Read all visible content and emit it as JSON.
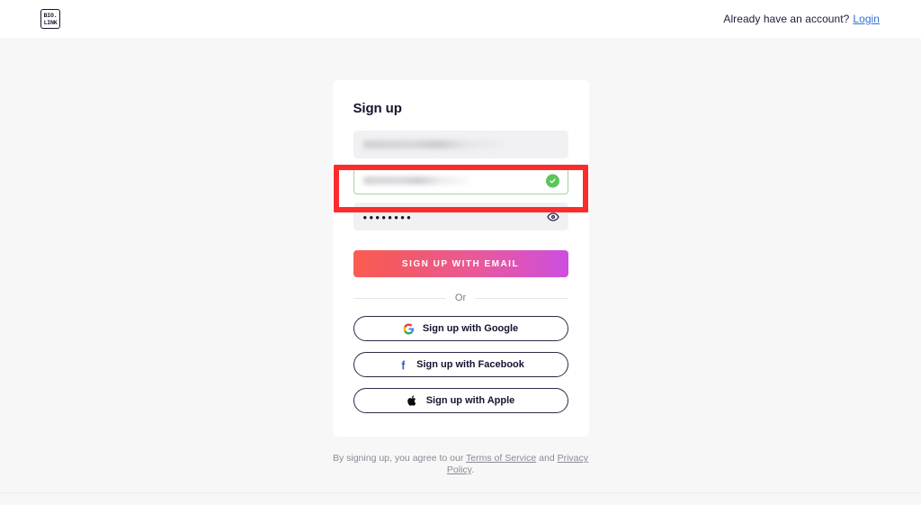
{
  "header": {
    "logo": {
      "name": "bio-link-logo",
      "line1": "BIO.",
      "line2": "LINK"
    },
    "account_prompt": "Already have an account?",
    "login_label": "Login"
  },
  "card": {
    "title": "Sign up",
    "fields": [
      {
        "name": "username-field",
        "value": "",
        "placeholder": "",
        "redacted": true,
        "state": "filled"
      },
      {
        "name": "email-field",
        "value": "",
        "placeholder": "",
        "redacted": true,
        "state": "valid",
        "validation_icon": "green-check-icon"
      },
      {
        "name": "password-field",
        "value": "••••••••",
        "placeholder": "",
        "redacted": false,
        "state": "filled",
        "trailing_icon": "eye-icon"
      }
    ],
    "primary_button": "SIGN UP WITH EMAIL",
    "divider_label": "Or",
    "social_buttons": [
      {
        "label": "Sign up with Google",
        "icon": "google-icon"
      },
      {
        "label": "Sign up with Facebook",
        "icon": "facebook-icon"
      },
      {
        "label": "Sign up with Apple",
        "icon": "apple-icon"
      }
    ]
  },
  "legal": {
    "prefix": "By signing up, you agree to our ",
    "terms_label": "Terms of Service",
    "conjunction": " and ",
    "privacy_label": "Privacy Policy",
    "suffix": "."
  },
  "colors": {
    "background": "#f7f7f8",
    "card": "#ffffff",
    "text": "#16142e",
    "link": "#2f6fdd",
    "gradient_start": "#fb5c51",
    "gradient_end": "#cd4ee0",
    "valid_border": "#9ed89a",
    "valid_check": "#5cc45c",
    "annotation": "#fa2c2c"
  }
}
